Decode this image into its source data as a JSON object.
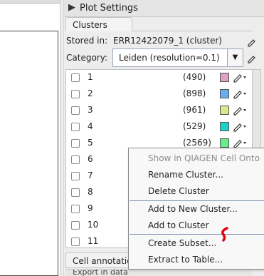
{
  "panel": {
    "header_arrow": "▶",
    "title": "Plot Settings",
    "tabs": [
      {
        "label": "Clusters"
      }
    ],
    "stored_in_label": "Stored in:",
    "stored_in_value": "ERR12422079_1 (cluster)",
    "category_label": "Category:",
    "category_value": "Leiden (resolution=0.1)"
  },
  "clusters": [
    {
      "name": "1",
      "count": "(490)",
      "color": "#e0a0c4"
    },
    {
      "name": "2",
      "count": "(898)",
      "color": "#66aef0"
    },
    {
      "name": "3",
      "count": "(961)",
      "color": "#dde88e"
    },
    {
      "name": "4",
      "count": "(529)",
      "color": "#1ad3c6"
    },
    {
      "name": "5",
      "count": "(2569)",
      "color": "#66ee88"
    },
    {
      "name": "6"
    },
    {
      "name": "7"
    },
    {
      "name": "8"
    },
    {
      "name": "9"
    },
    {
      "name": "10"
    },
    {
      "name": "11"
    }
  ],
  "context_menu": {
    "items": [
      {
        "label": "Show in QIAGEN Cell Onto",
        "enabled": false
      },
      {
        "label": "Rename Cluster...",
        "enabled": true
      },
      {
        "label": "Delete Cluster",
        "enabled": true
      },
      {
        "label": "Add to New Cluster...",
        "enabled": true
      },
      {
        "label": "Add to Cluster",
        "enabled": true
      },
      {
        "label": "Create Subset...",
        "enabled": true
      },
      {
        "label": "Extract to Table...",
        "enabled": true
      }
    ]
  },
  "bottom_tab": {
    "label": "Cell annotatio"
  },
  "bottom_strip": {
    "label": "Export in data"
  },
  "icons": {
    "edit": "pencil-dropdown-icon",
    "side": "settings-icon",
    "select_arrow": "▼"
  },
  "colors": {
    "cursor": "#e8000e",
    "menu_separator": "#7d8fb3"
  }
}
